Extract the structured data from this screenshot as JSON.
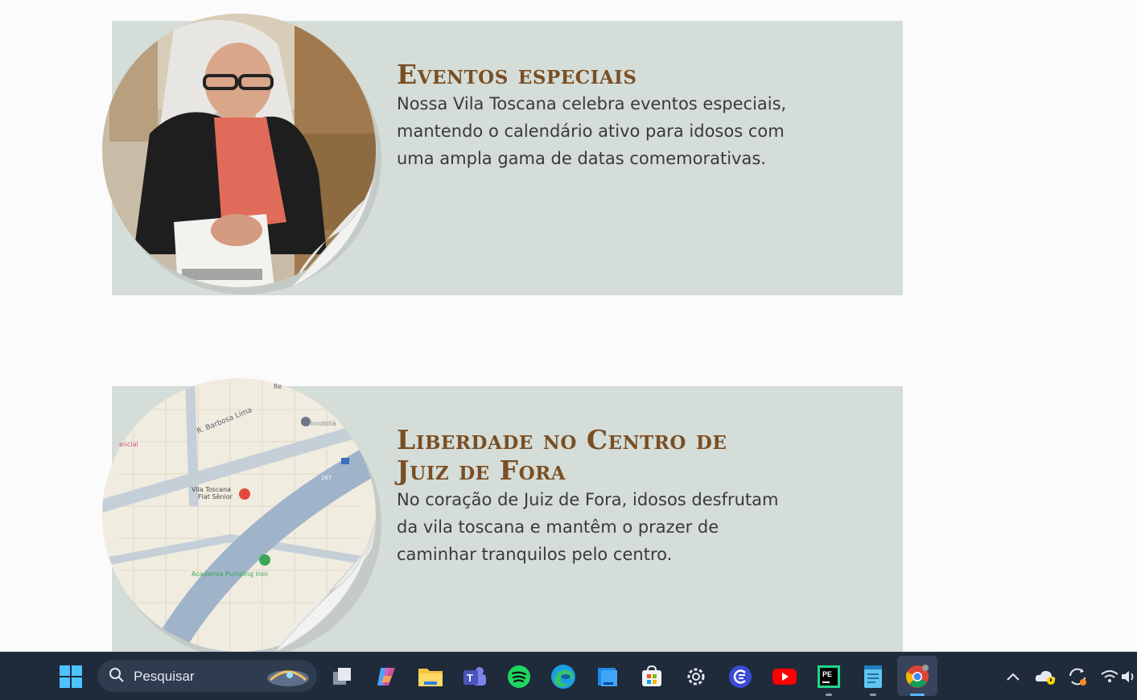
{
  "sections": [
    {
      "title": "Eventos especiais",
      "body": "Nossa Vila Toscana celebra eventos especiais, mantendo o calendário ativo para idosos com uma ampla gama de datas comemorativas."
    },
    {
      "title": "Liberdade no Centro de Juiz de Fora",
      "body": "No coração de Juiz de Fora, idosos desfrutam da vila toscana e mantêm o prazer de caminhar tranquilos pelo centro.",
      "map_labels": {
        "street": "R. Barbosa Lima",
        "place": "Vila Toscana",
        "place_sub": "Flat Sênior",
        "gym": "Academia Pumping Iron",
        "top_right": "Imobiliá",
        "left_edge": "encial",
        "top_edge": "Re",
        "road_number": "267"
      }
    }
  ],
  "taskbar": {
    "search_placeholder": "Pesquisar",
    "apps": [
      "start-icon",
      "task-view-icon",
      "copilot-icon",
      "file-explorer-icon",
      "teams-icon",
      "spotify-icon",
      "edge-icon",
      "notepad-blue-icon",
      "store-icon",
      "settings-icon",
      "ai-search-icon",
      "youtube-icon",
      "pycharm-icon",
      "notepad-icon",
      "chrome-icon"
    ],
    "pe_label": "PE"
  },
  "colors": {
    "card_bg": "#d5ddd8",
    "title": "#7a4f24",
    "body_text": "#3a3a3a",
    "taskbar_bg": "#1f2a3b"
  }
}
